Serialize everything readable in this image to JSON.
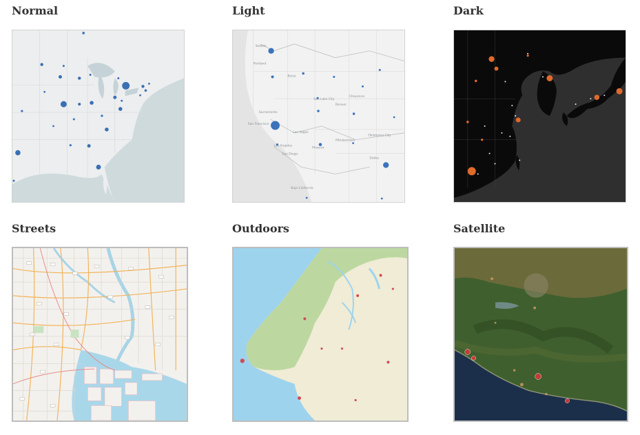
{
  "map_styles": [
    {
      "title": "Normal"
    },
    {
      "title": "Light"
    },
    {
      "title": "Dark"
    },
    {
      "title": "Streets"
    },
    {
      "title": "Outdoors"
    },
    {
      "title": "Satellite"
    }
  ],
  "light_map_labels": [
    "Seattle",
    "Portland",
    "Boise",
    "Sacramento",
    "San Francisco",
    "Las Vegas",
    "Phoenix",
    "Los Angeles",
    "San Diego",
    "Denver",
    "Salt Lake City",
    "Albuquerque",
    "Oklahoma City",
    "Dallas",
    "Cheyenne",
    "Baja California"
  ],
  "colors": {
    "normal_marker": "#3a6fb3",
    "light_marker": "#3b73bc",
    "dark_marker": "#e06a2c",
    "outdoors_marker": "#d24a55",
    "satellite_marker": "#d03a36"
  }
}
